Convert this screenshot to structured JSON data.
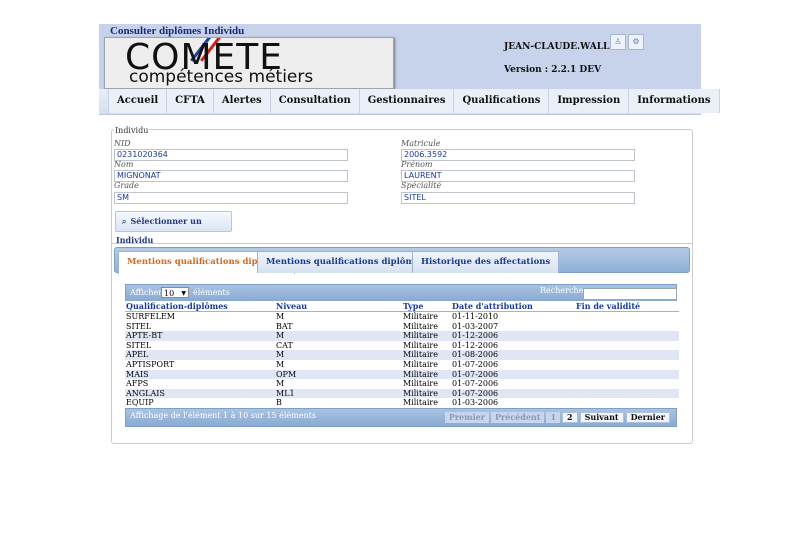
{
  "header": {
    "page_title": "Consulter diplômes Individu",
    "logo_title": "COMETE",
    "logo_subtitle": "compétences métiers",
    "user_name": "JEAN-CLAUDE.WALLET",
    "version": "Version : 2.2.1 DEV"
  },
  "menu": [
    "Accueil",
    "CFTA",
    "Alertes",
    "Consultation",
    "Gestionnaires",
    "Qualifications",
    "Impression",
    "Informations"
  ],
  "individu": {
    "legend": "Individu",
    "nid_label": "NID",
    "nid_value": "0231020364",
    "matricule_label": "Matricule",
    "matricule_value": "2006.3592",
    "nom_label": "Nom",
    "nom_value": "MIGNONAT",
    "prenom_label": "Prénom",
    "prenom_value": "LAURENT",
    "grade_label": "Grade",
    "grade_value": "SM",
    "specialite_label": "Spécialité",
    "specialite_value": "SITEL",
    "select_button": "Sélectionner un Individu"
  },
  "tabs": [
    "Mentions qualifications diplômes",
    "Mentions qualifications diplômes AO",
    "Historique des affectations"
  ],
  "table": {
    "show_label": "Afficher",
    "page_size": "10",
    "elements_label": "éléments",
    "search_label": "Rechercher:",
    "columns": [
      "Qualification-diplômes",
      "Niveau",
      "Type",
      "Date d'attribution",
      "Fin de validité"
    ],
    "rows": [
      [
        "SURFELEM",
        "M",
        "Militaire",
        "01-11-2010",
        ""
      ],
      [
        "SITEL",
        "BAT",
        "Militaire",
        "01-03-2007",
        ""
      ],
      [
        "APTE-BT",
        "M",
        "Militaire",
        "01-12-2006",
        ""
      ],
      [
        "SITEL",
        "CAT",
        "Militaire",
        "01-12-2006",
        ""
      ],
      [
        "APEL",
        "M",
        "Militaire",
        "01-08-2006",
        ""
      ],
      [
        "APTISPORT",
        "M",
        "Militaire",
        "01-07-2006",
        ""
      ],
      [
        "MAIS",
        "OPM",
        "Militaire",
        "01-07-2006",
        ""
      ],
      [
        "AFPS",
        "M",
        "Militaire",
        "01-07-2006",
        ""
      ],
      [
        "ANGLAIS",
        "ML1",
        "Militaire",
        "01-07-2006",
        ""
      ],
      [
        "EQUIP",
        "B",
        "Militaire",
        "01-03-2006",
        ""
      ]
    ],
    "info": "Affichage de l'élément 1 à 10 sur 15 éléments",
    "pager": {
      "first": "Premier",
      "prev": "Précédent",
      "p1": "1",
      "p2": "2",
      "next": "Suivant",
      "last": "Dernier"
    }
  },
  "colors": {
    "header_bg": "#c6d3ea",
    "active_tab": "#d2691e",
    "link_blue": "#1a3a9a",
    "row_alt": "#e0e6f5"
  }
}
